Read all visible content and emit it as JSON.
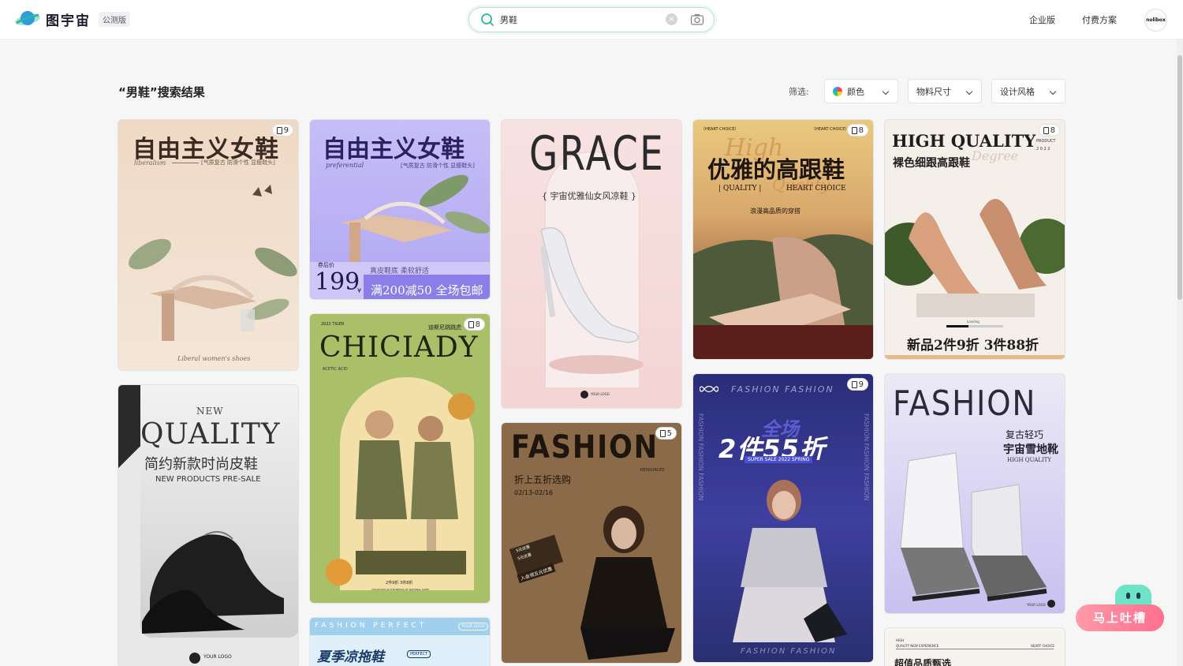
{
  "brand": {
    "name": "图宇宙",
    "badge": "公测版",
    "primary": "#2fb59a"
  },
  "search": {
    "value": "男鞋"
  },
  "nav": {
    "enterprise": "企业版",
    "pricing": "付费方案",
    "avatar_text": "nolibox"
  },
  "results": {
    "title": "“男鞋”搜索结果"
  },
  "filters": {
    "label": "筛选:",
    "color": "颜色",
    "size": "物料尺寸",
    "style": "设计风格"
  },
  "cards": [
    {
      "count": "9",
      "headline": "自由主义女鞋",
      "sub": "liberalism",
      "tags": "[气质复古 防滑个性 显瘦鞋头]",
      "footer": "Liberal women's shoes"
    },
    {
      "headline": "NEW",
      "headline2": "QUALITY",
      "sub": "简约新款时尚皮鞋",
      "tags": "NEW PRODUCTS PRE-SALE",
      "footer": "YOUR LOGO"
    },
    {
      "headline": "自由主义女鞋",
      "sub": "preferential",
      "tags": "[气质复古 防滑个性 显瘦鞋头]",
      "price_label": "券后价",
      "price": "199",
      "price_unit": "¥",
      "feature": "真皮鞋底 柔软舒适",
      "promo": "满200减50 全场包邮"
    },
    {
      "count": "8",
      "brand_top": "2022 TIGER",
      "brand_right": "迪斯尼跳跳虎",
      "headline": "CHICIADY",
      "sub": "ACETIC ACID",
      "promo": "2件9折 3件8折",
      "footer": "CHILDHOOD IN THE PERIOD OF NATIONAL SLEEP"
    },
    {
      "headline": "FASHION PERFECT",
      "sub": "夏季凉拖鞋",
      "tag": "PERFECT",
      "logo": "YOUR LOGO"
    },
    {
      "headline": "GRACE",
      "sub": "{ 宇宙优雅仙女风凉鞋 }",
      "footer": "YOUR LOGO"
    },
    {
      "count": "5",
      "headline": "FASHION",
      "sub": "折上五折选购",
      "date": "02/13-02/16",
      "resources": "RESOURCES",
      "t1": "5元优惠",
      "t2": "5元优惠",
      "t3": "入会领五元优惠"
    },
    {
      "count": "8",
      "top_left": "〔HEART CHOICE〕",
      "top_right": "〔HEART CHOICE〕",
      "deco": "High",
      "headline": "优雅的高跟鞋",
      "left_tag": "| QUALITY |",
      "right_tag": "HEART CHOICE",
      "deco2": "Quality",
      "sub": "浪漫高品质的穿搭"
    },
    {
      "count": "9",
      "band": "FASHION FASHION",
      "top": "全场",
      "headline": "2件55折",
      "strip": "SUPER SALE 2022 SPRING",
      "side": "FASHION FASHION FASHION",
      "bottom": "FASHION FASHION"
    },
    {
      "count": "8",
      "headline": "HIGH QUALITY",
      "sub": "裸色细跟高跟鞋",
      "deco": "Degree",
      "product": "PRODUCT",
      "year": "2 0 2 2",
      "loading": "Loading",
      "promo": "新品2件9折 3件88折"
    },
    {
      "headline": "FASHION",
      "sub1": "复古轻巧",
      "sub2": "宇宙雪地靴",
      "sub3": "HIGH QUALITY",
      "footer": "YOUR LOGO"
    },
    {
      "top_left": "HIGH",
      "top_left2": "QUALITY NEW EXPERIENCE",
      "top_right": "HEART CHOICE",
      "headline": "超值品质甄选"
    }
  ],
  "feedback": {
    "label": "马上吐槽"
  }
}
